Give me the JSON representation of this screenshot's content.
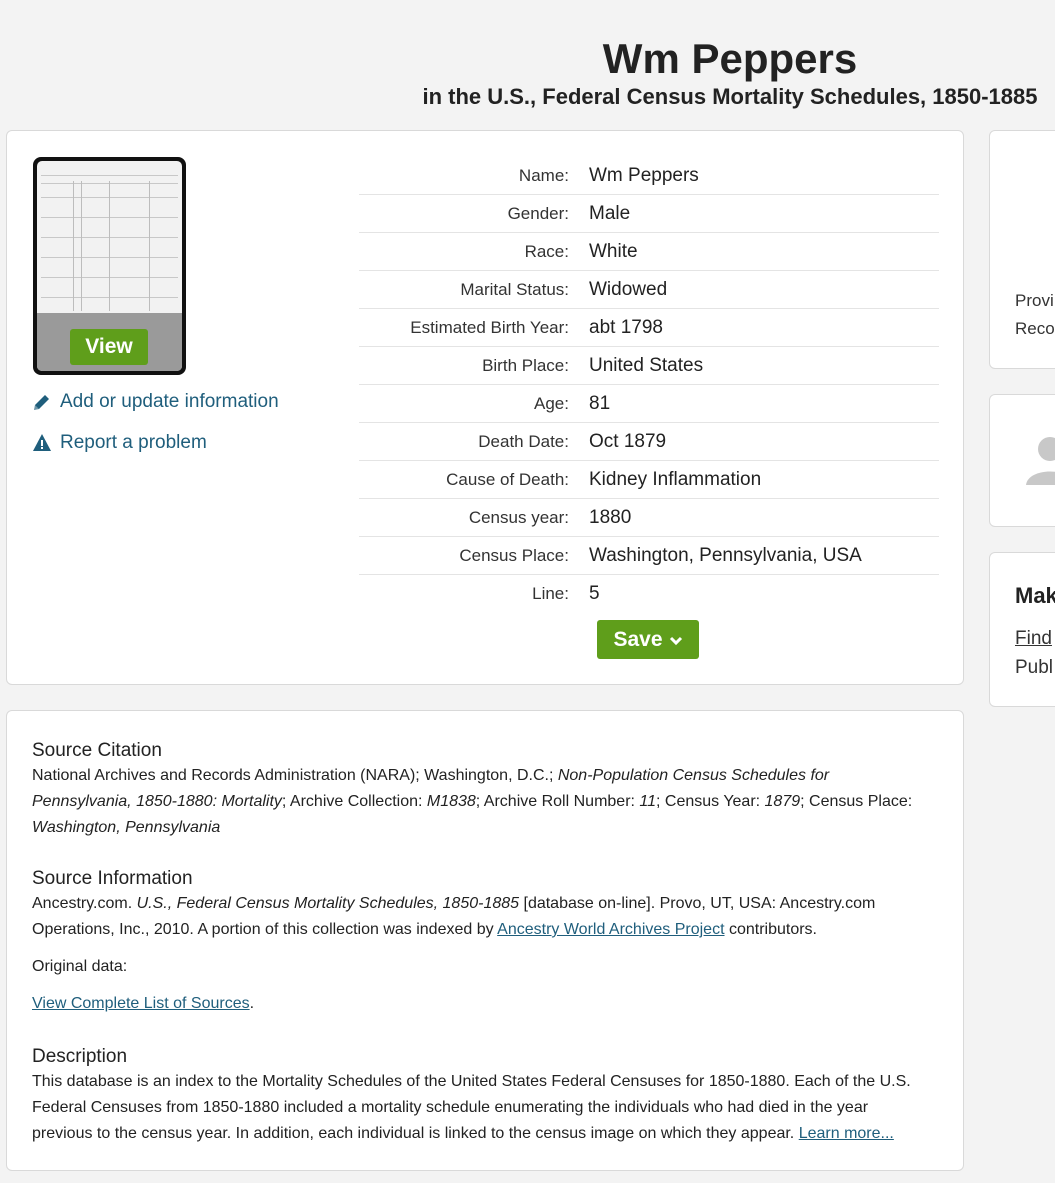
{
  "header": {
    "name": "Wm Peppers",
    "collection_line": "in the U.S., Federal Census Mortality Schedules, 1850-1885"
  },
  "record": {
    "view_label": "View",
    "add_update_label": "Add or update information",
    "report_label": "Report a problem",
    "save_label": "Save",
    "fields": [
      {
        "label": "Name:",
        "value": "Wm Peppers"
      },
      {
        "label": "Gender:",
        "value": "Male"
      },
      {
        "label": "Race:",
        "value": "White"
      },
      {
        "label": "Marital Status:",
        "value": "Widowed"
      },
      {
        "label": "Estimated Birth Year:",
        "value": "abt 1798"
      },
      {
        "label": "Birth Place:",
        "value": "United States"
      },
      {
        "label": "Age:",
        "value": "81"
      },
      {
        "label": "Death Date:",
        "value": "Oct 1879"
      },
      {
        "label": "Cause of Death:",
        "value": "Kidney Inflammation"
      },
      {
        "label": "Census year:",
        "value": "1880"
      },
      {
        "label": "Census Place:",
        "value": "Washington, Pennsylvania, USA"
      },
      {
        "label": "Line:",
        "value": "5"
      }
    ]
  },
  "source": {
    "citation_heading": "Source Citation",
    "citation": {
      "p1": "National Archives and Records Administration (NARA); Washington, D.C.; ",
      "i1": "Non-Population Census Schedules for Pennsylvania, 1850-1880: Mortality",
      "p2": "; Archive Collection: ",
      "i2": "M1838",
      "p3": "; Archive Roll Number: ",
      "i3": "11",
      "p4": "; Census Year: ",
      "i4": "1879",
      "p5": "; Census Place: ",
      "i5": "Washington, Pennsylvania"
    },
    "info_heading": "Source Information",
    "info": {
      "p1": "Ancestry.com. ",
      "i1": "U.S., Federal Census Mortality Schedules, 1850-1885",
      "p2": " [database on-line]. Provo, UT, USA: Ancestry.com Operations, Inc., 2010. A portion of this collection was indexed by ",
      "link": "Ancestry World Archives Project",
      "p3": " contributors."
    },
    "original_data": "Original data:",
    "complete_list_link": "View Complete List of Sources",
    "complete_list_period": ".",
    "description_heading": "Description",
    "description": "This database is an index to the Mortality Schedules of the United States Federal Censuses for 1850-1880. Each of the U.S. Federal Censuses from 1850-1880 included a mortality schedule enumerating the individuals who had died in the year previous to the census year. In addition, each individual is linked to the census image on which they appear. ",
    "learn_more": "Learn more..."
  },
  "sidebar": {
    "card1_line1": "Provi",
    "card1_line2": "Recor",
    "card3_heading": "Mak",
    "card3_link": "Find",
    "card3_line": "Publ"
  },
  "colors": {
    "accent_green": "#5f9e1b",
    "link_blue": "#1f5e7c"
  }
}
